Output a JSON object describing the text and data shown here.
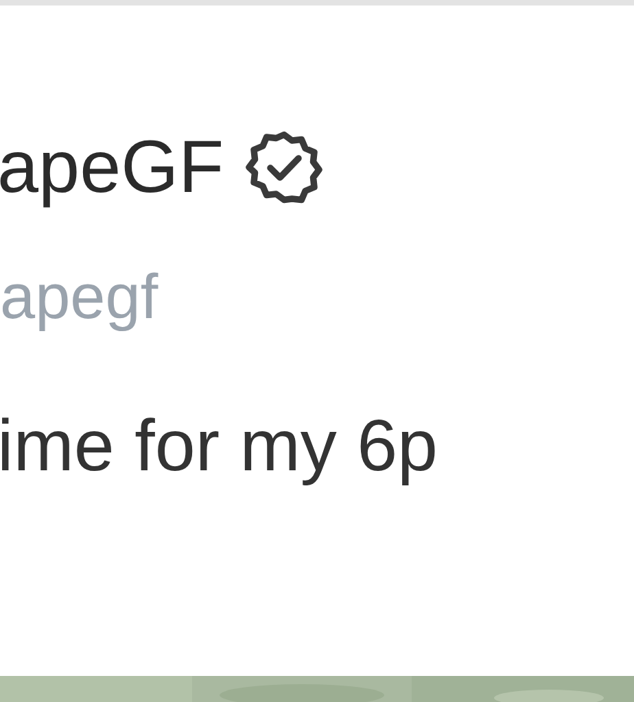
{
  "post": {
    "author_name": "apeGF",
    "verified": true,
    "handle": "apegf",
    "text": "ime for my 6p"
  }
}
